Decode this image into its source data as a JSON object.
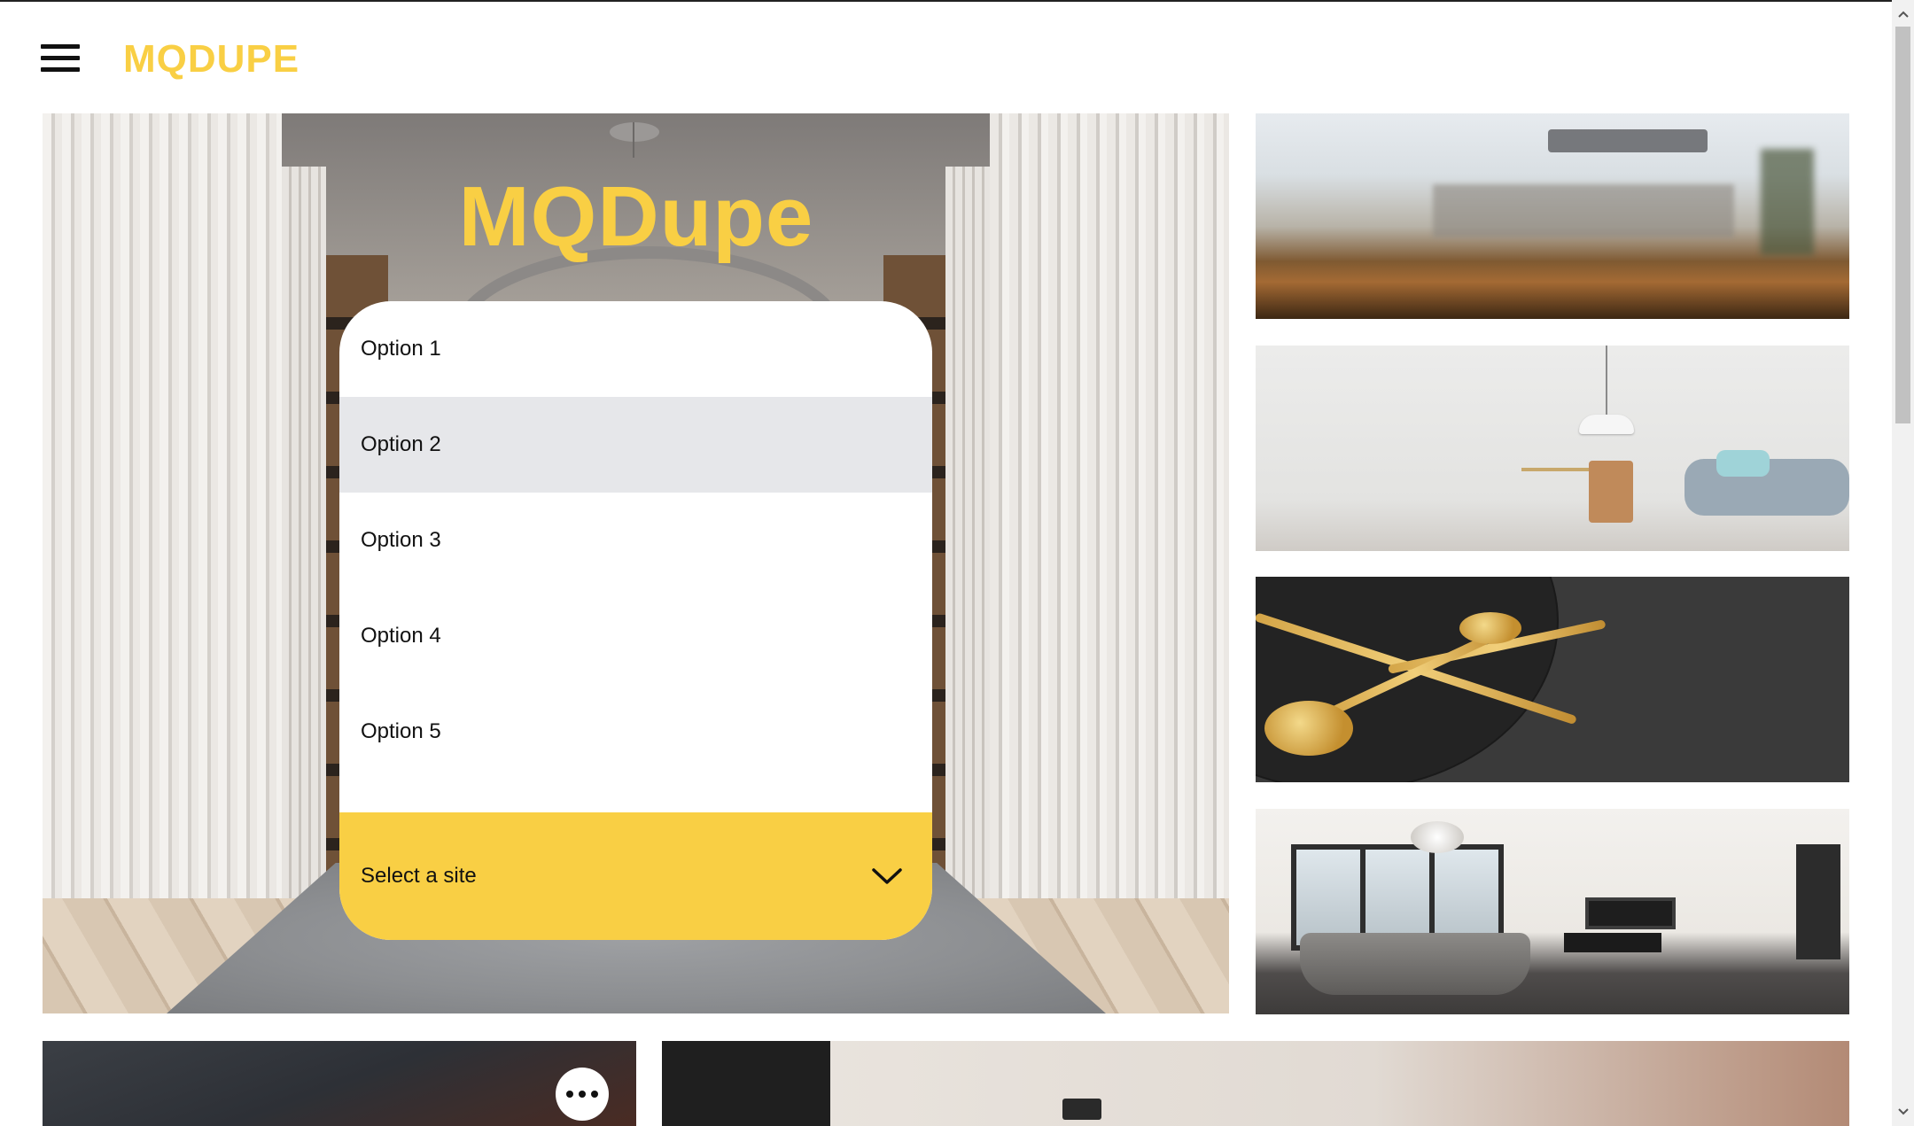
{
  "header": {
    "brand": "MQDUPE"
  },
  "hero": {
    "title": "MQDupe",
    "dropdown": {
      "options": [
        "Option 1",
        "Option 2",
        "Option 3",
        "Option 4",
        "Option 5"
      ],
      "highlighted_option": "Option 2",
      "select_label": "Select a site"
    }
  },
  "colors": {
    "accent": "#f9cf44",
    "highlight": "#e6e7ea"
  },
  "icons": {
    "menu": "hamburger-menu-icon",
    "chevron": "chevron-down-icon",
    "more": "more-horizontal-icon"
  }
}
